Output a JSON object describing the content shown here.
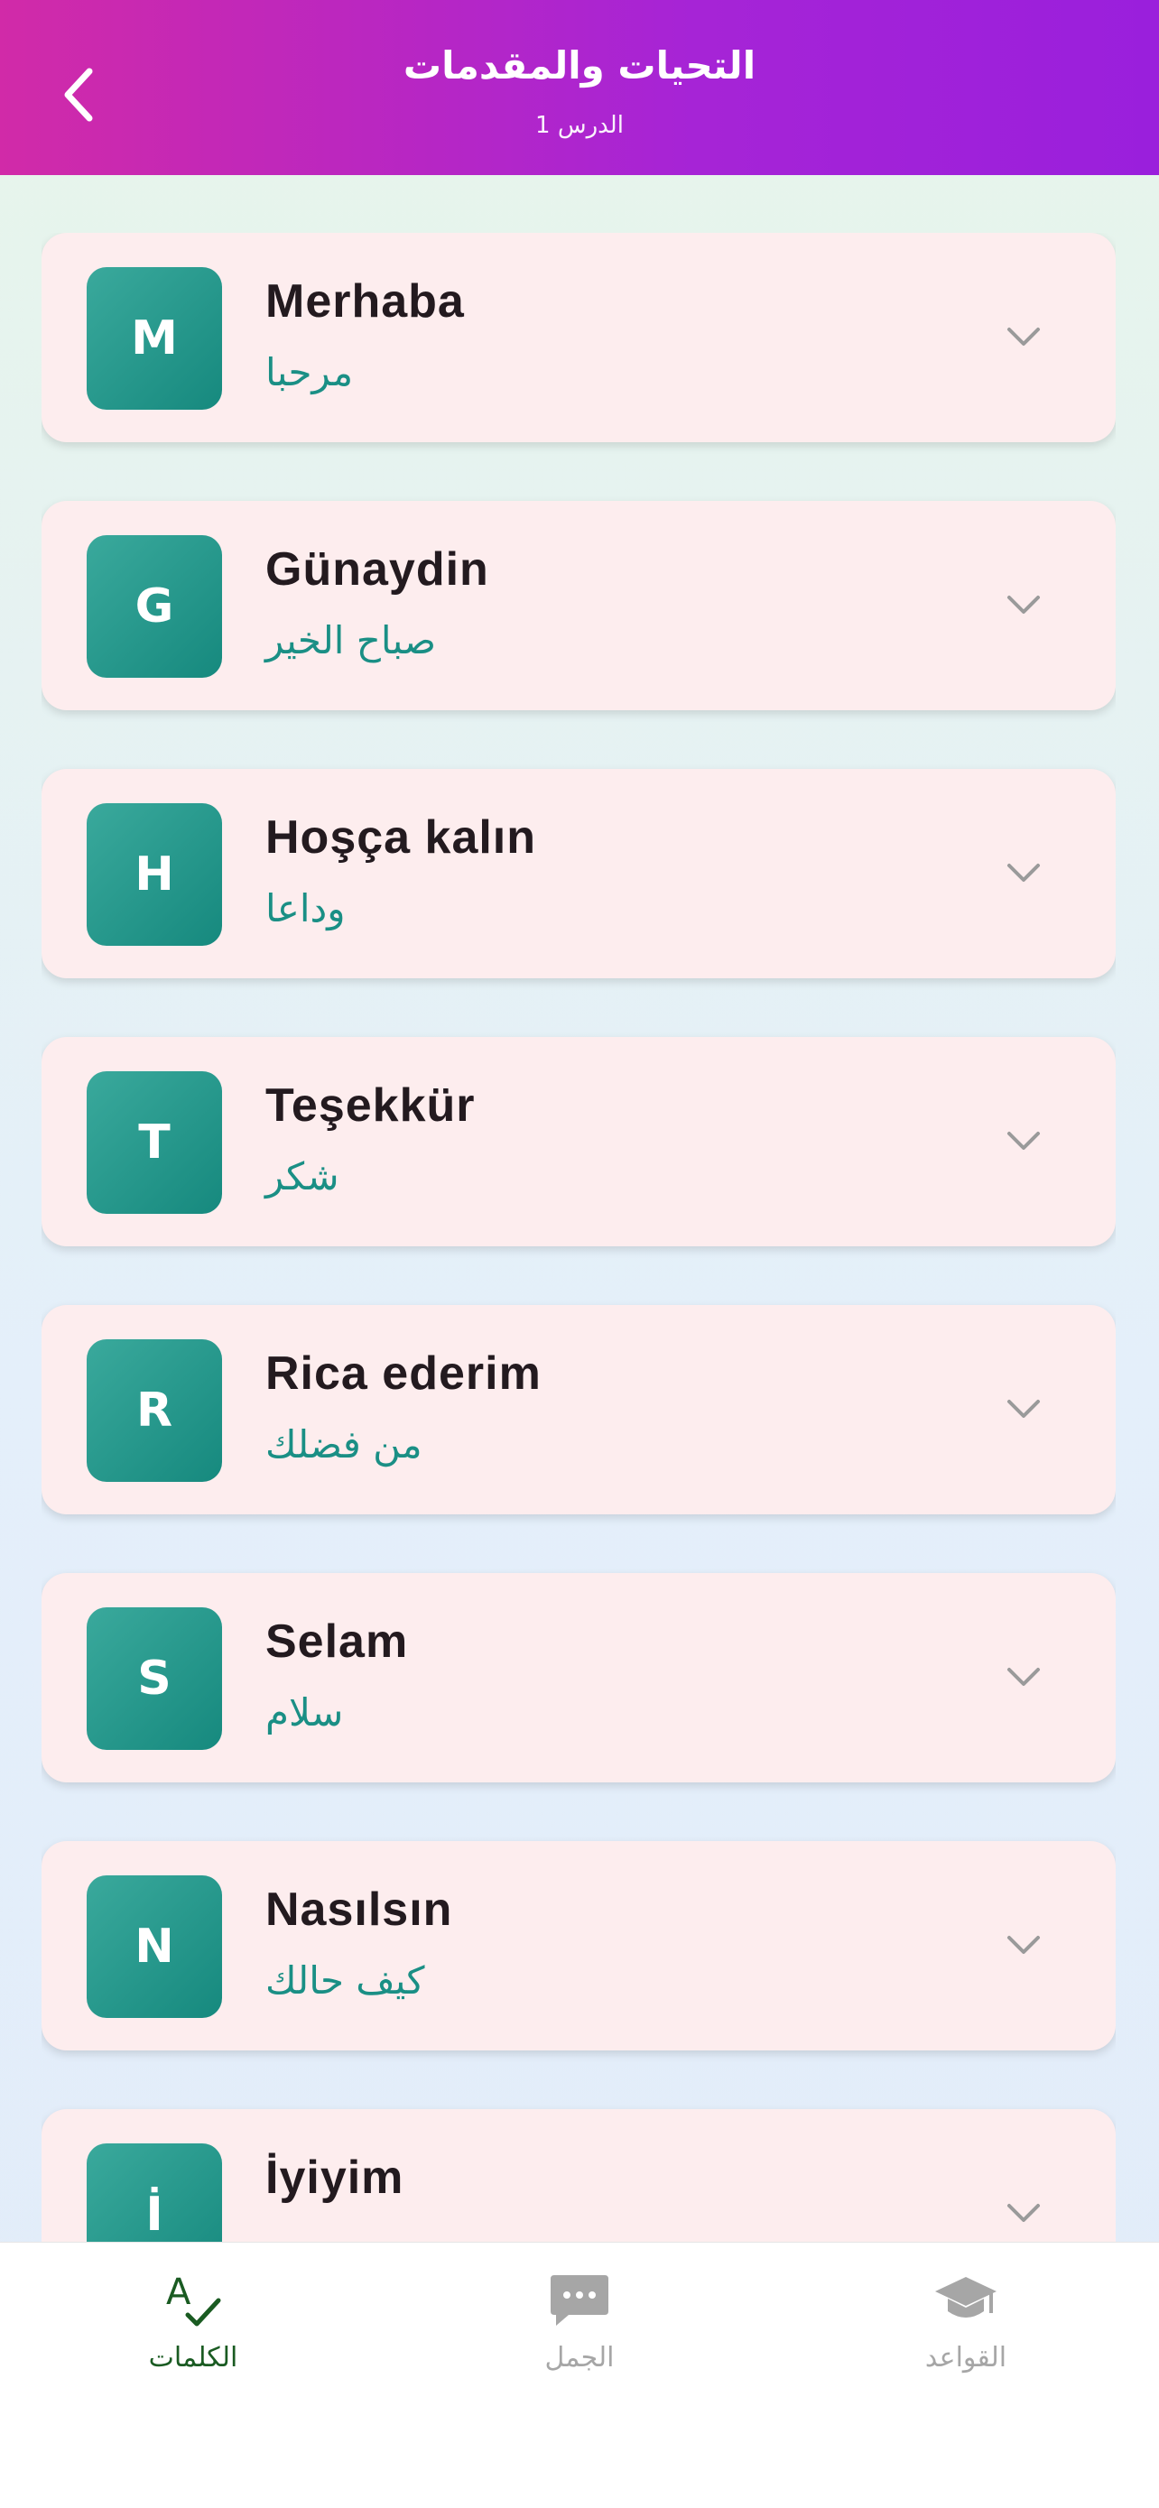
{
  "header": {
    "title": "التحيات والمقدمات",
    "subtitle": "الدرس 1"
  },
  "words": [
    {
      "letter": "M",
      "word": "Merhaba",
      "translation": "مرحبا"
    },
    {
      "letter": "G",
      "word": "Günaydin",
      "translation": "صباح الخير"
    },
    {
      "letter": "H",
      "word": "Hoşça kalın",
      "translation": "وداعا"
    },
    {
      "letter": "T",
      "word": "Teşekkür",
      "translation": "شكر"
    },
    {
      "letter": "R",
      "word": "Rica ederim",
      "translation": "من فضلك"
    },
    {
      "letter": "S",
      "word": "Selam",
      "translation": "سلام"
    },
    {
      "letter": "N",
      "word": "Nasılsın",
      "translation": "كيف حالك"
    },
    {
      "letter": "İ",
      "word": "İyiyim",
      "translation": ""
    }
  ],
  "bottom_nav": {
    "words_label": "الكلمات",
    "sentences_label": "الجمل",
    "grammar_label": "القواعد"
  },
  "colors": {
    "header_start": "#d12aa8",
    "header_end": "#9a1fdc",
    "avatar": "#16897e",
    "translation": "#1a8f85",
    "nav_active": "#1a5b22",
    "card_bg": "#fdedee"
  }
}
